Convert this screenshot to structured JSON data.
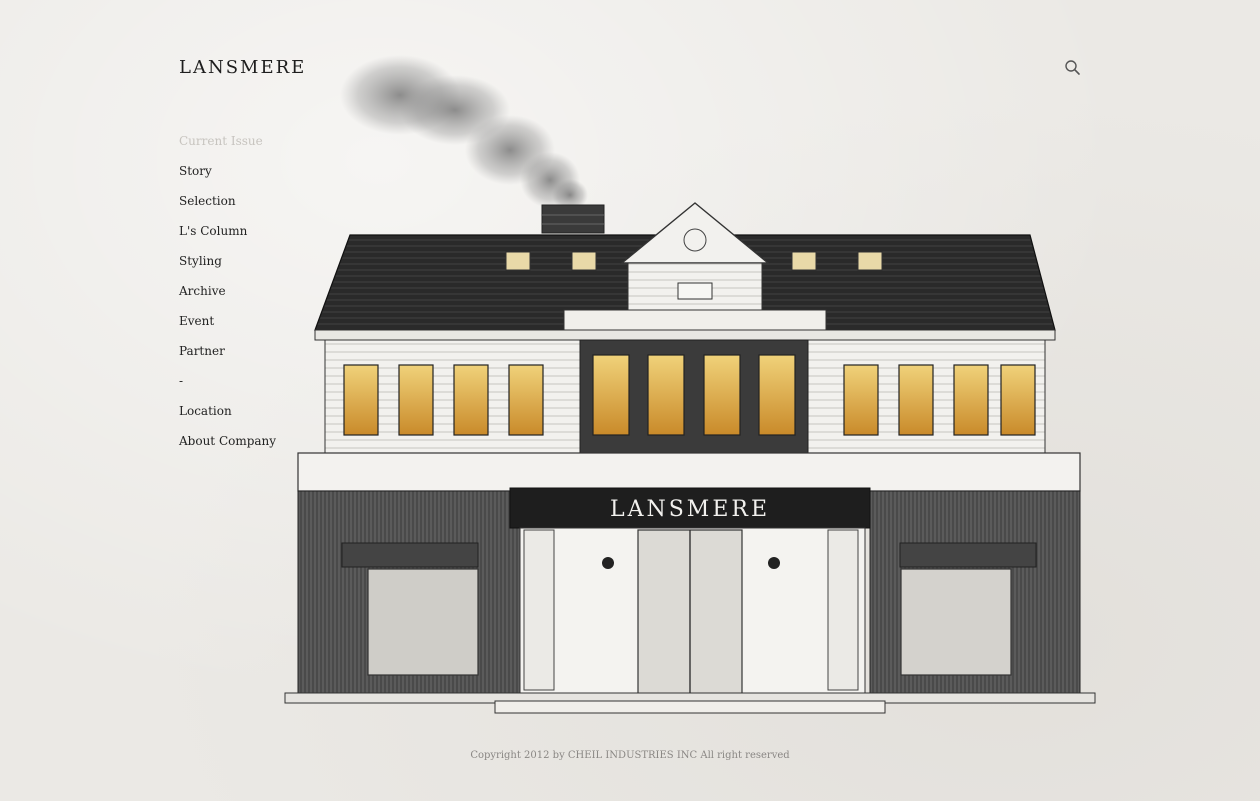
{
  "brand": {
    "logo": "LANSMERE",
    "sign": "LANSMERE"
  },
  "header": {
    "search_icon": "search-icon"
  },
  "nav": {
    "items": [
      {
        "label": "Current Issue",
        "state": "muted"
      },
      {
        "label": "Story"
      },
      {
        "label": "Selection"
      },
      {
        "label": "L's Column"
      },
      {
        "label": "Styling"
      },
      {
        "label": "Archive"
      },
      {
        "label": "Event"
      },
      {
        "label": "Partner"
      },
      {
        "label": "-"
      },
      {
        "label": "Location"
      },
      {
        "label": "About Company"
      }
    ]
  },
  "footer": {
    "copyright": "Copyright 2012 by CHEIL INDUSTRIES INC All right reserved"
  },
  "colors": {
    "background": "#ebe9e5",
    "text": "#222222",
    "muted": "#c7c4bf",
    "roof": "#2b2b2b",
    "window_glow": "#e0b64a"
  }
}
